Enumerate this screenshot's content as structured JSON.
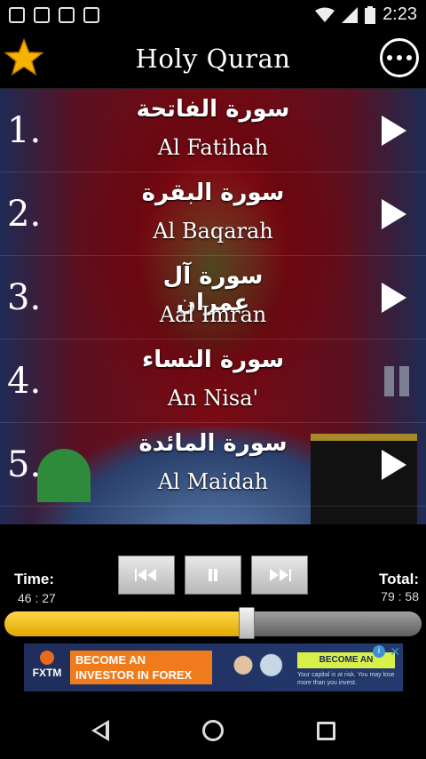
{
  "statusbar": {
    "time": "2:23",
    "notification_icons": [
      "android-icon",
      "clipboard-check-icon",
      "clipboard-check-icon",
      "media-icon"
    ]
  },
  "header": {
    "title": "Holy Quran",
    "favorite_icon": "star-icon",
    "menu_icon": "more-icon"
  },
  "surahs": [
    {
      "number": "1.",
      "arabic": "سورة الفاتحة",
      "english": "Al Fatihah",
      "state": "play"
    },
    {
      "number": "2.",
      "arabic": "سورة البقرة",
      "english": "Al Baqarah",
      "state": "play"
    },
    {
      "number": "3.",
      "arabic": "سورة آل عمران",
      "english": "Aal Imran",
      "state": "play"
    },
    {
      "number": "4.",
      "arabic": "سورة النساء",
      "english": "An Nisa'",
      "state": "pause"
    },
    {
      "number": "5.",
      "arabic": "سورة المائدة",
      "english": "Al Maidah",
      "state": "play"
    }
  ],
  "player": {
    "time_label": "Time:",
    "time_value": "46 : 27",
    "total_label": "Total:",
    "total_value": "79 : 58",
    "progress_fraction": 0.58
  },
  "ad": {
    "brand": "FXTM",
    "headline": "BECOME AN INVESTOR IN FOREX",
    "cta": "BECOME AN INVESTOR",
    "disclaimer": "Your capital is at risk. You may lose more than you invest."
  },
  "colors": {
    "accent_star": "#f5b400",
    "progress_fill": "#f3c21d",
    "background": "#000000"
  }
}
